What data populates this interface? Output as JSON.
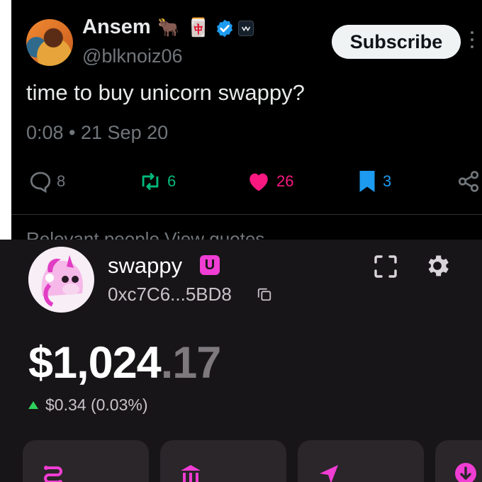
{
  "tweet": {
    "author_name": "Ansem",
    "author_emojis": [
      "🐂",
      "🀄"
    ],
    "handle": "@blknoiz06",
    "subscribe_label": "Subscribe",
    "text": "time to buy unicorn swappy?",
    "timestamp": "0:08 • 21 Sep 20",
    "replies": "8",
    "reposts": "6",
    "likes": "26",
    "bookmarks": "3",
    "partial_text": "Relevant people          View quotes",
    "colors": {
      "background": "#000000",
      "verified": "#1d9bf0",
      "repost": "#00ba7c",
      "like": "#f91880",
      "bookmark": "#1d9bf0",
      "muted": "#71767b"
    },
    "icons": [
      "reply-icon",
      "repost-icon",
      "like-icon",
      "bookmark-icon",
      "share-icon",
      "verified-badge-icon",
      "more-icon"
    ]
  },
  "wallet": {
    "account_name": "swappy",
    "account_badge": "U",
    "address": "0xc7C6...5BD8",
    "balance_int": "$1,024",
    "balance_dec": ".17",
    "change": "$0.34 (0.03%)",
    "colors": {
      "background": "#171517",
      "accent": "#f03dd3",
      "positive": "#2fd15c",
      "tile": "#2a262a"
    },
    "icons": [
      "unicorn-logo",
      "copy-icon",
      "scan-icon",
      "gear-icon",
      "swap-icon",
      "bank-icon",
      "send-icon",
      "receive-icon"
    ]
  }
}
